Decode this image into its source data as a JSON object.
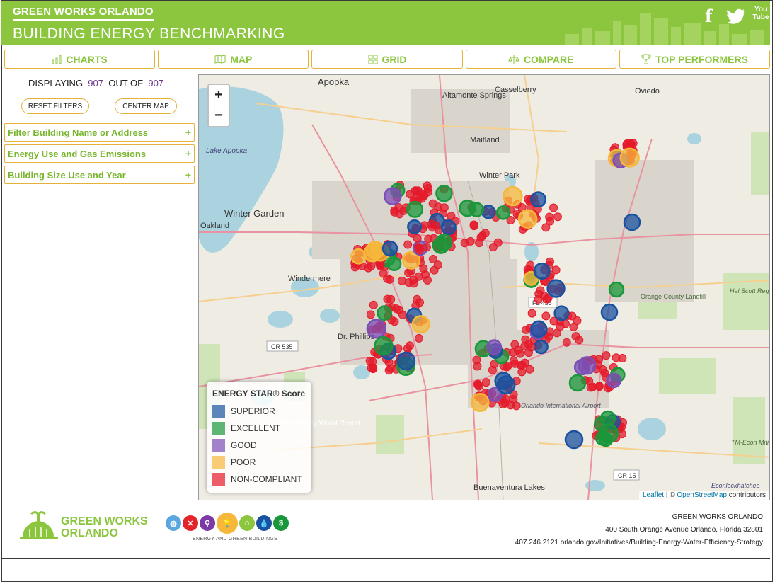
{
  "header": {
    "brand": "GREEN WORKS ORLANDO",
    "subtitle": "BUILDING ENERGY BENCHMARKING",
    "social": [
      "facebook-icon",
      "twitter-icon",
      "youtube-icon"
    ],
    "youtube_label": "You Tube",
    "color": "#8cc63f"
  },
  "tabs": [
    {
      "label": "CHARTS",
      "icon": "bar-chart-icon"
    },
    {
      "label": "MAP",
      "icon": "map-icon"
    },
    {
      "label": "GRID",
      "icon": "grid-icon"
    },
    {
      "label": "COMPARE",
      "icon": "compare-icon"
    },
    {
      "label": "TOP PERFORMERS",
      "icon": "trophy-icon"
    }
  ],
  "sidebar": {
    "displaying_label": "DISPLAYING",
    "displayed_count": "907",
    "out_of_label": "OUT OF",
    "total_count": "907",
    "reset_button": "RESET FILTERS",
    "center_button": "CENTER MAP",
    "filters": [
      {
        "label": "Filter Building Name or Address"
      },
      {
        "label": "Energy Use and Gas Emissions"
      },
      {
        "label": "Building Size Use and Year"
      }
    ]
  },
  "map": {
    "zoom_in": "+",
    "zoom_out": "−",
    "places": [
      "Apopka",
      "Altamonte Springs",
      "Casselberry",
      "Oviedo",
      "Maitland",
      "Winter Park",
      "Winter Garden",
      "Oakland",
      "Lake Apopka",
      "Windermere",
      "Dr. Phillips",
      "Orange County Landfill",
      "Hal Scott Regional Preserve and Park",
      "Orlando International Airport",
      "Walt Disney World Resort",
      "TM-Econ Mitigation Bank",
      "Buenaventura Lakes",
      "Econlockhatchee",
      "CR 535",
      "CR 15",
      "FL 436"
    ],
    "legend": {
      "title": "ENERGY STAR® Score",
      "items": [
        {
          "label": "SUPERIOR",
          "color": "#1a52a0"
        },
        {
          "label": "EXCELLENT",
          "color": "#19973a"
        },
        {
          "label": "GOOD",
          "color": "#7b4fb5"
        },
        {
          "label": "POOR",
          "color": "#f5b83a"
        },
        {
          "label": "NON-COMPLIANT",
          "color": "#e41a2a"
        }
      ]
    },
    "attribution_leaflet": "Leaflet",
    "attribution_sep": "| ©",
    "attribution_osm": "OpenStreetMap",
    "attribution_tail": "contributors"
  },
  "footer": {
    "logo_line1": "GREEN WORKS",
    "logo_line2": "ORLANDO",
    "category_label": "ENERGY AND GREEN BUILDINGS",
    "org": "GREEN WORKS ORLANDO",
    "address": "400 South Orange Avenue  Orlando, Florida 32801",
    "contact": "407.246.2121  orlando.gov/Initiatives/Building-Energy-Water-Efficiency-Strategy",
    "icons": [
      {
        "name": "community-icon",
        "color": "#5aa6e0"
      },
      {
        "name": "food-icon",
        "color": "#e3242b"
      },
      {
        "name": "bike-icon",
        "color": "#7b3aa8"
      },
      {
        "name": "lightbulb-icon",
        "color": "#f5b83a"
      },
      {
        "name": "house-icon",
        "color": "#8cc63f"
      },
      {
        "name": "water-drop-icon",
        "color": "#1a52a0"
      },
      {
        "name": "dollar-icon",
        "color": "#19973a"
      }
    ]
  }
}
